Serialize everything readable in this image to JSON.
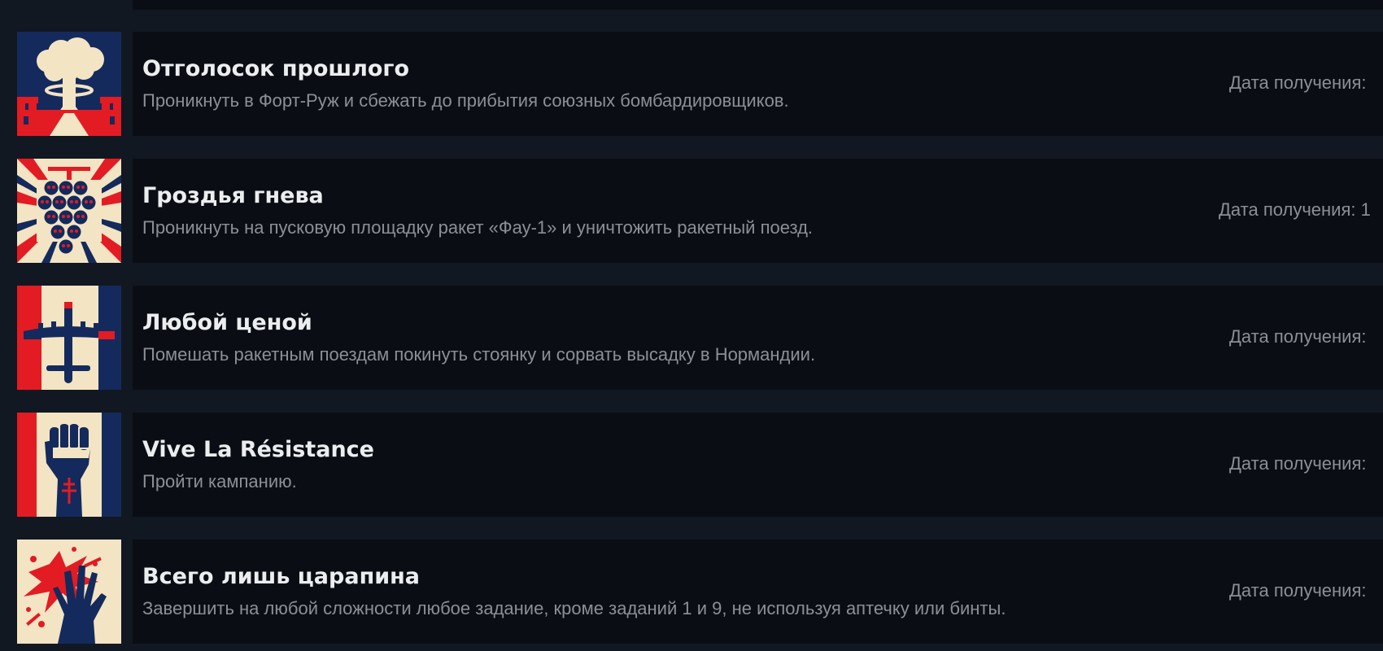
{
  "colors": {
    "page_bg": "#121821",
    "card_bg": "#0a0e14",
    "title": "#ebedef",
    "muted": "#8c9095",
    "icon_red": "#e31b23",
    "icon_navy": "#142a5c",
    "icon_cream": "#f3e4c4"
  },
  "achievements": [
    {
      "icon": "mushroom-cloud-icon",
      "title": "Отголосок прошлого",
      "description": "Проникнуть в Форт-Руж и сбежать до прибытия союзных бомбардировщиков.",
      "date_label": "Дата получения:"
    },
    {
      "icon": "skull-grapes-icon",
      "title": "Гроздья гнева",
      "description": "Проникнуть на пусковую площадку ракет «Фау-1» и уничтожить ракетный поезд.",
      "date_label": "Дата получения: 1"
    },
    {
      "icon": "bomber-plane-icon",
      "title": "Любой ценой",
      "description": "Помешать ракетным поездам покинуть стоянку и сорвать высадку в Нормандии.",
      "date_label": "Дата получения:"
    },
    {
      "icon": "raised-fist-icon",
      "title": "Vive La Résistance",
      "description": "Пройти кампанию.",
      "date_label": "Дата получения:"
    },
    {
      "icon": "bloody-hand-icon",
      "title": "Всего лишь царапина",
      "description": "Завершить на любой сложности любое задание, кроме заданий 1 и 9, не используя аптечку или бинты.",
      "date_label": "Дата получения:"
    }
  ]
}
